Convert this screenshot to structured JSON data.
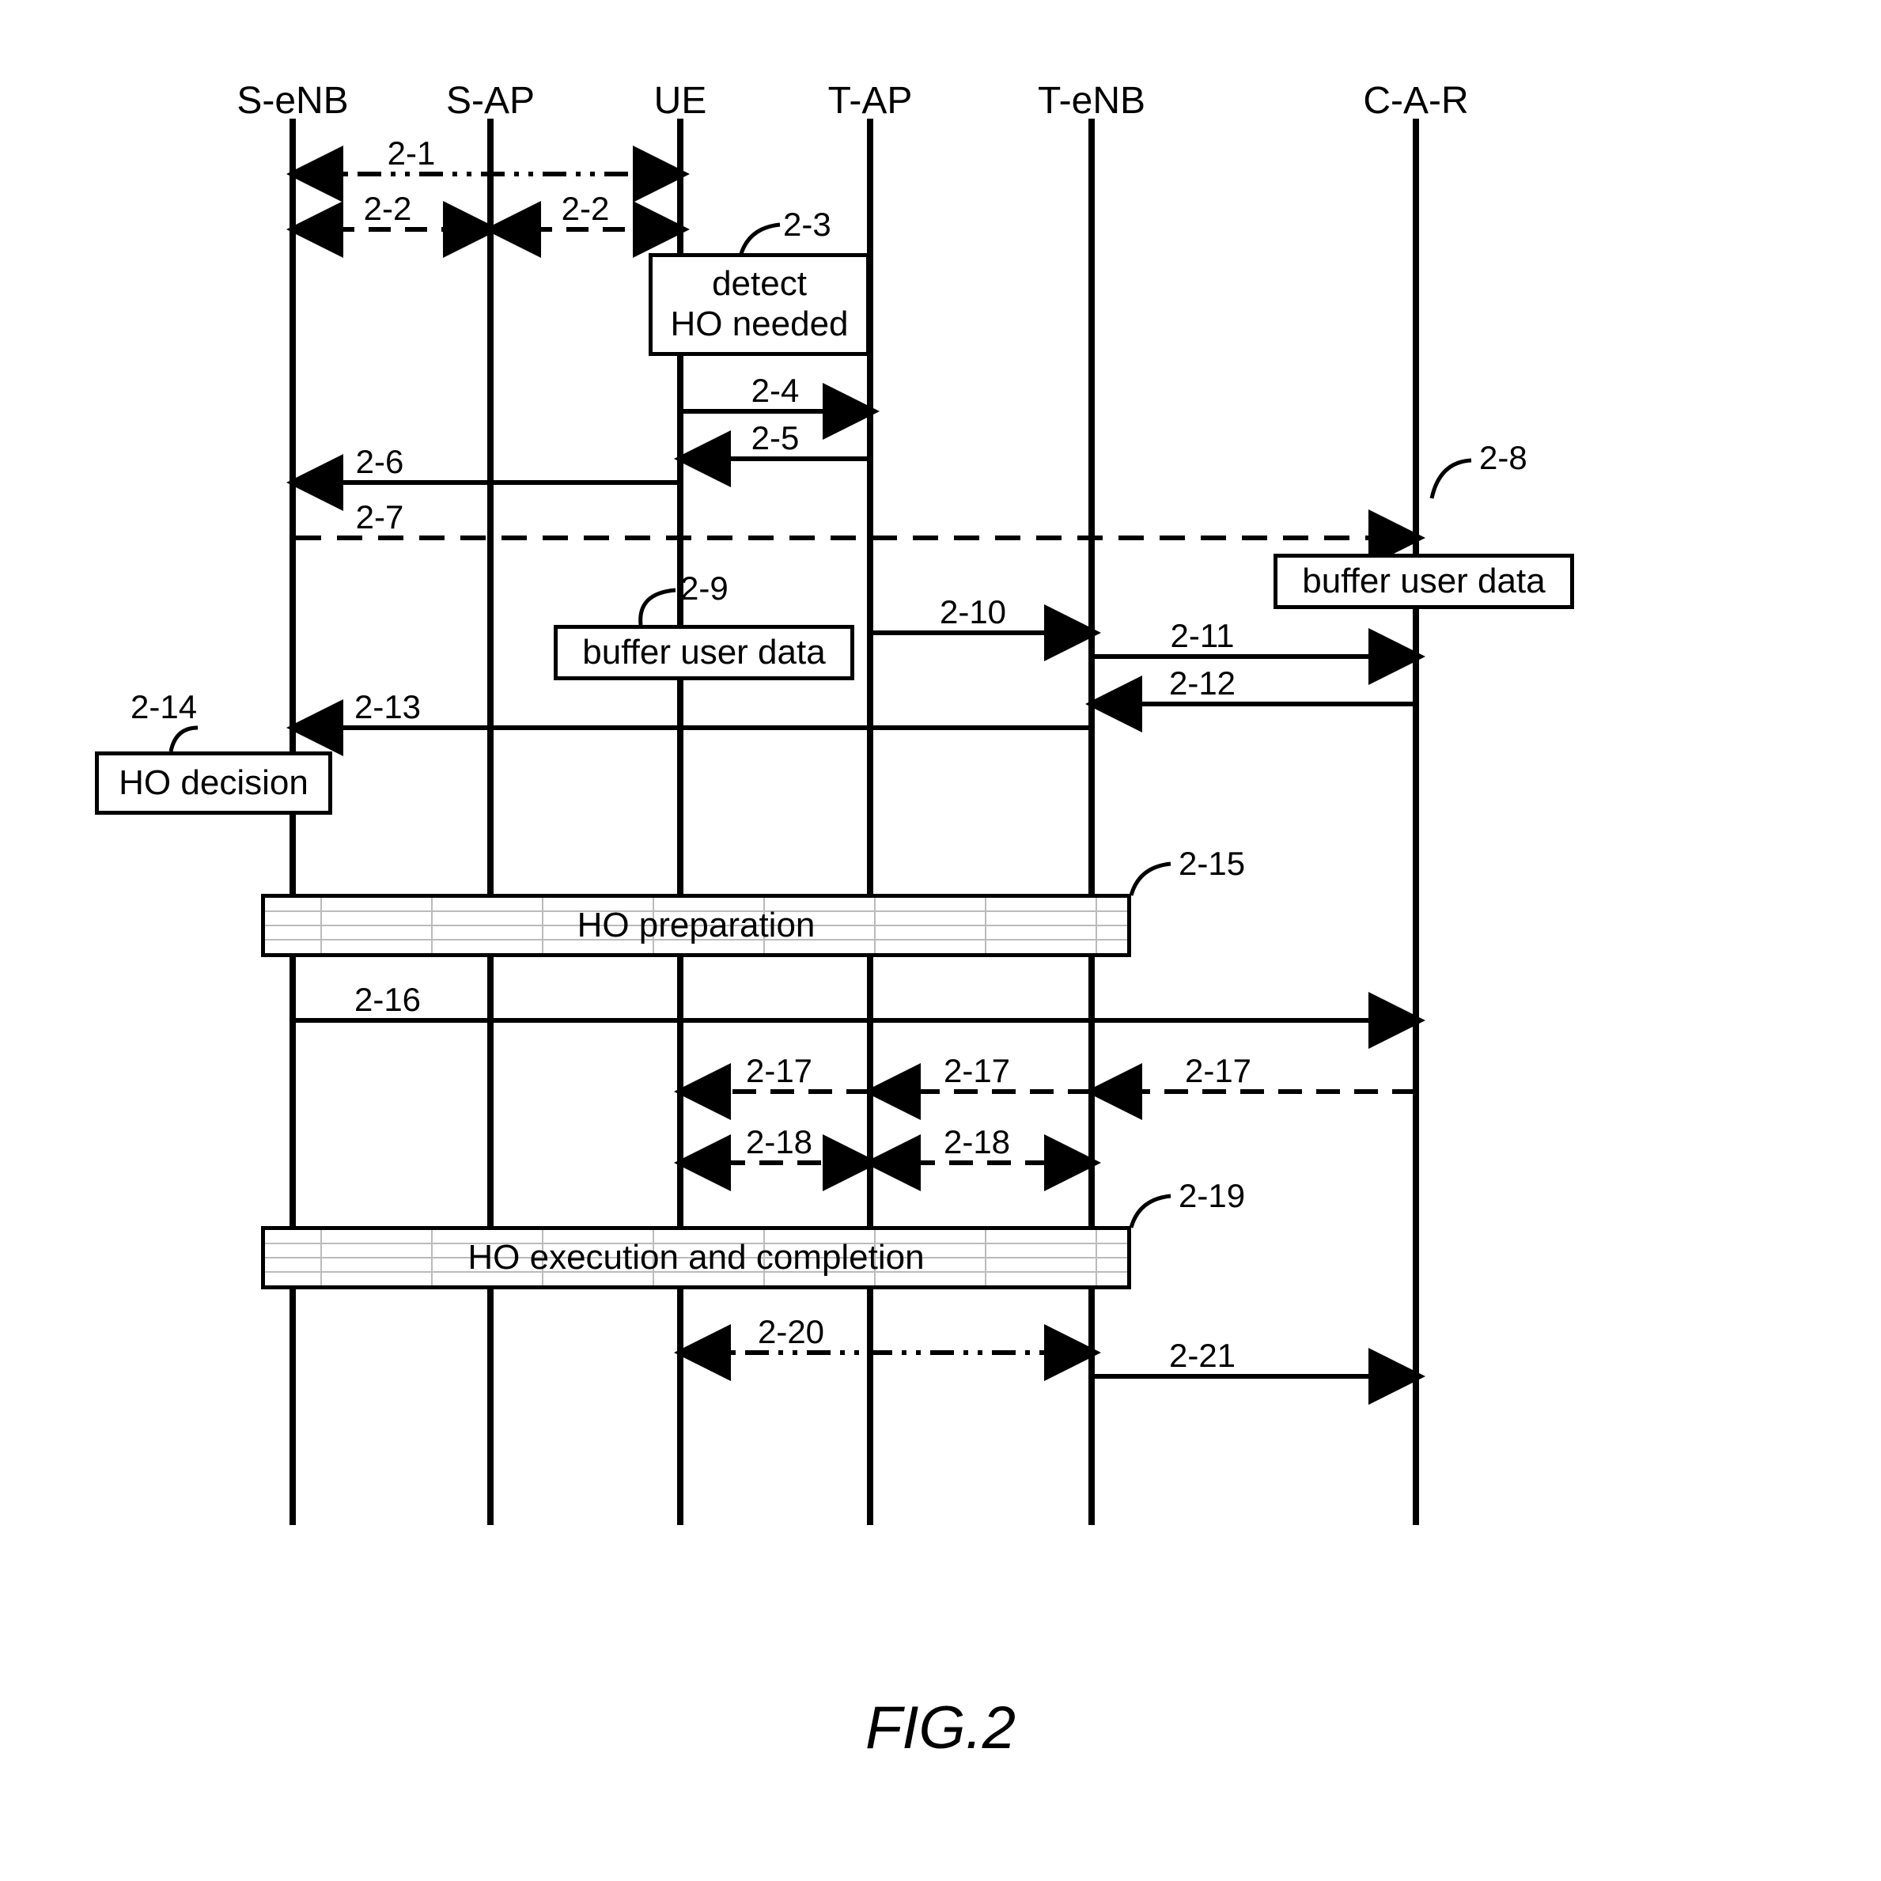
{
  "figure_label": "FIG.2",
  "lifelines": {
    "senb": "S-eNB",
    "sap": "S-AP",
    "ue": "UE",
    "tap": "T-AP",
    "tenb": "T-eNB",
    "car": "C-A-R"
  },
  "messages": {
    "m2_1": "2-1",
    "m2_2a": "2-2",
    "m2_2b": "2-2",
    "m2_3": "2-3",
    "m2_4": "2-4",
    "m2_5": "2-5",
    "m2_6": "2-6",
    "m2_7": "2-7",
    "m2_8": "2-8",
    "m2_9": "2-9",
    "m2_10": "2-10",
    "m2_11": "2-11",
    "m2_12": "2-12",
    "m2_13": "2-13",
    "m2_14": "2-14",
    "m2_15": "2-15",
    "m2_16": "2-16",
    "m2_17a": "2-17",
    "m2_17b": "2-17",
    "m2_17c": "2-17",
    "m2_18a": "2-18",
    "m2_18b": "2-18",
    "m2_19": "2-19",
    "m2_20": "2-20",
    "m2_21": "2-21"
  },
  "boxes": {
    "detect_ho": "detect\nHO needed",
    "buffer_car": "buffer user data",
    "buffer_ue": "buffer user data",
    "ho_decision": "HO decision",
    "ho_prep": "HO preparation",
    "ho_exec": "HO execution and completion"
  }
}
